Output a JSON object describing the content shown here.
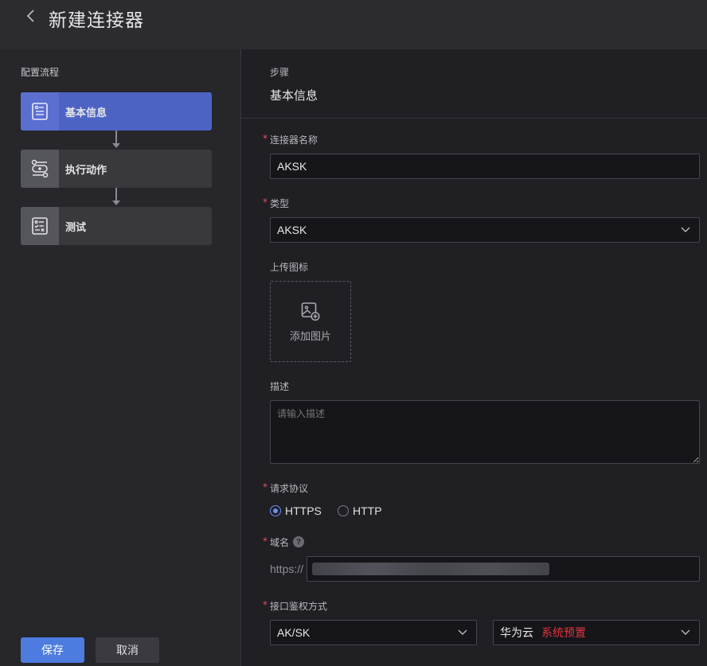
{
  "header": {
    "title": "新建连接器"
  },
  "sidebar": {
    "flow_label": "配置流程",
    "steps": [
      {
        "label": "基本信息",
        "icon": "document-list-icon",
        "active": true
      },
      {
        "label": "执行动作",
        "icon": "action-flow-icon",
        "active": false
      },
      {
        "label": "测试",
        "icon": "checklist-icon",
        "active": false
      }
    ]
  },
  "buttons": {
    "save": "保存",
    "cancel": "取消"
  },
  "form": {
    "step_caption": "步骤",
    "step_name": "基本信息",
    "name_label": "连接器名称",
    "name_value": "AKSK",
    "type_label": "类型",
    "type_value": "AKSK",
    "upload_label": "上传图标",
    "upload_text": "添加图片",
    "desc_label": "描述",
    "desc_placeholder": "请输入描述",
    "protocol_label": "请求协议",
    "protocol_options": [
      "HTTPS",
      "HTTP"
    ],
    "protocol_selected": "HTTPS",
    "domain_label": "域名",
    "domain_prefix": "https://",
    "auth_label": "接口鉴权方式",
    "auth_value": "AK/SK",
    "provider_value": "华为云",
    "provider_tag": "系统预置"
  },
  "colors": {
    "accent": "#4d63c4",
    "primary_button": "#4d7be0",
    "required": "#e8505b",
    "tag": "#e5333d"
  }
}
